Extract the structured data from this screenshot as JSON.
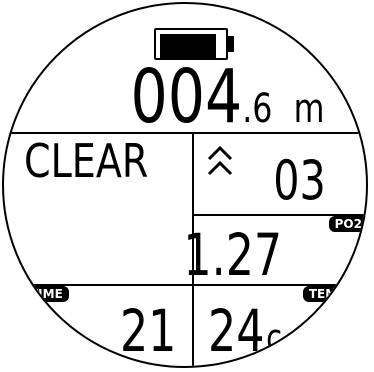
{
  "battery": {
    "level": 0.85,
    "icon": "battery-icon"
  },
  "depth": {
    "integer": "004",
    "decimal": ".6",
    "unit": "m"
  },
  "status": {
    "text": "CLEAR"
  },
  "ascent": {
    "icon": "double-chevron-up-icon",
    "value": "03"
  },
  "po2": {
    "label": "PO2",
    "value": "1.27"
  },
  "time": {
    "label": "TIME",
    "value": "21"
  },
  "temp": {
    "label": "TEMP",
    "value": "24",
    "unit": "c"
  },
  "colors": {
    "foreground": "#000000",
    "background": "#ffffff"
  }
}
